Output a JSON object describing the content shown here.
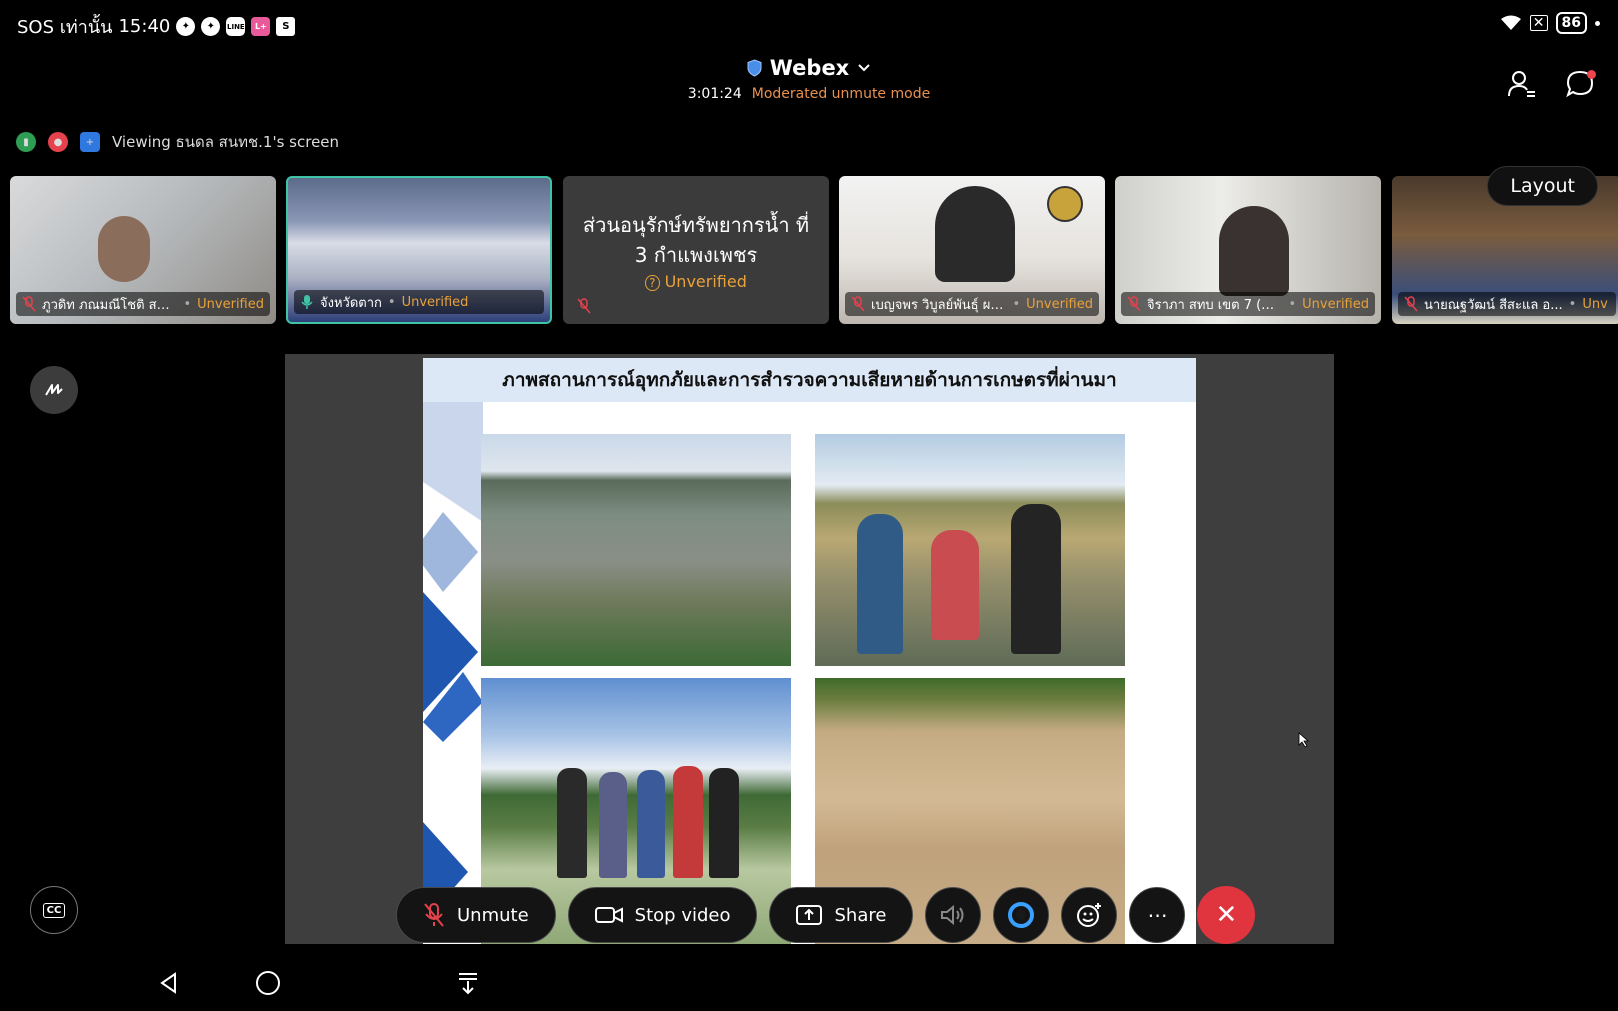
{
  "status_bar": {
    "carrier": "SOS เท่านั้น",
    "time": "15:40",
    "battery": "86",
    "app_icons": [
      "messenger-icon",
      "messenger-icon",
      "line-icon",
      "lineplus-icon",
      "shop-icon"
    ]
  },
  "header": {
    "app_title": "Webex",
    "elapsed": "3:01:24",
    "mode": "Moderated unmute mode"
  },
  "viewing": {
    "text": "Viewing ธนดล สนทช.1's screen"
  },
  "participants": [
    {
      "name": "ภูวดิท ภณมณีโชติ สนง....",
      "status": "Unverified",
      "video": true,
      "mic": "off",
      "active": false
    },
    {
      "name": "จังหวัดตาก",
      "status": "Unverified",
      "video": true,
      "mic": "on",
      "active": true
    },
    {
      "name": "ส่วนอนุรักษ์ทรัพยากรน้ำ ที่ 3 กำแพงเพชร",
      "status": "Unverified",
      "video": false,
      "mic": "off",
      "active": false
    },
    {
      "name": "เบญจพร วิบูลย์พันธุ์ ผอ ...",
      "status": "Unverified",
      "video": true,
      "mic": "off",
      "active": false
    },
    {
      "name": "จิราภา สทบ เขต 7 (กำแ...",
      "status": "Unverified",
      "video": true,
      "mic": "off",
      "active": false
    },
    {
      "name": "นายณฐวัฒน์ สีสะแล อ...",
      "status": "Unv",
      "video": true,
      "mic": "off",
      "active": false
    }
  ],
  "layout_button": "Layout",
  "slide": {
    "title": "ภาพสถานการณ์อุทกภัยและการสำรวจความเสียหายด้านการเกษตรที่ผ่านมา"
  },
  "toolbar": {
    "unmute": "Unmute",
    "stop_video": "Stop video",
    "share": "Share",
    "more": "⋯"
  },
  "colors": {
    "accent": "#3ec3a7",
    "warning": "#e9a23a",
    "end_call": "#e0343f",
    "mode_text": "#e8914e"
  }
}
